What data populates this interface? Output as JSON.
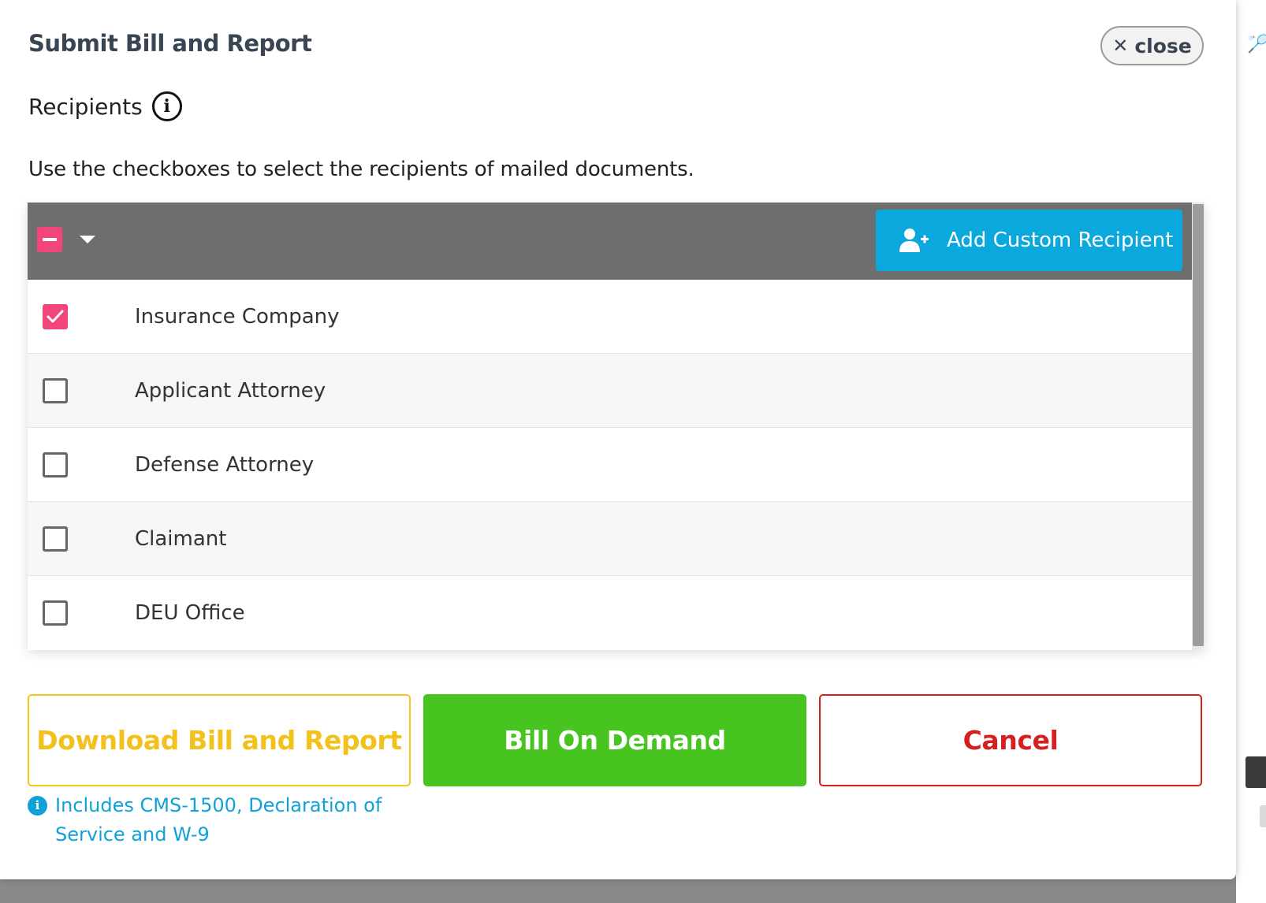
{
  "modal": {
    "title": "Submit Bill and Report",
    "close_label": "close",
    "recipients_label": "Recipients",
    "instructions": "Use the checkboxes to select the recipients of mailed documents."
  },
  "table": {
    "add_button_label": "Add Custom Recipient",
    "rows": [
      {
        "label": "Insurance Company",
        "checked": true
      },
      {
        "label": "Applicant Attorney",
        "checked": false
      },
      {
        "label": "Defense Attorney",
        "checked": false
      },
      {
        "label": "Claimant",
        "checked": false
      },
      {
        "label": "DEU Office",
        "checked": false
      }
    ]
  },
  "actions": {
    "download_label": "Download Bill and Report",
    "bill_label": "Bill On Demand",
    "cancel_label": "Cancel",
    "download_note": "Includes CMS-1500, Declaration of Service and W-9"
  },
  "icons": {
    "close": "close-icon",
    "info": "info-icon",
    "add_user": "add-user-icon",
    "caret": "caret-down-icon",
    "check": "check-icon"
  },
  "colors": {
    "accent_pink": "#f2467a",
    "primary_blue": "#0aa8dd",
    "success_green": "#47c41f",
    "warning_yellow": "#f2c11c",
    "danger_red": "#d61f1f"
  }
}
